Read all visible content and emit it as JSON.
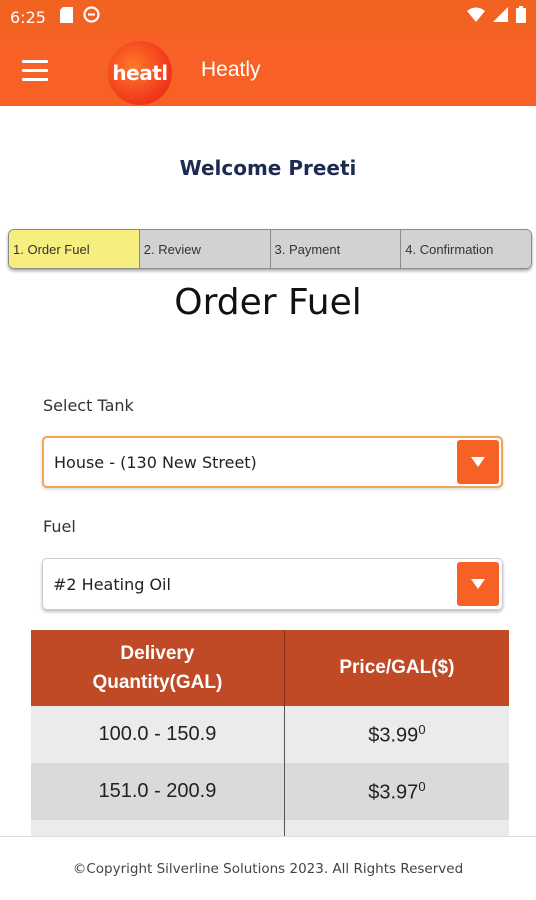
{
  "status_bar": {
    "time": "6:25",
    "icons": [
      "sd-card-icon",
      "do-not-disturb-icon",
      "wifi-icon",
      "signal-icon",
      "battery-icon"
    ]
  },
  "app_bar": {
    "logo_text": "heatl",
    "title": "Heatly",
    "color": "#f86125"
  },
  "welcome": "Welcome Preeti",
  "steps": [
    {
      "label": "1. Order Fuel",
      "active": true
    },
    {
      "label": "2. Review",
      "active": false
    },
    {
      "label": "3. Payment",
      "active": false
    },
    {
      "label": "4. Confirmation",
      "active": false
    }
  ],
  "page_title": "Order Fuel",
  "tank": {
    "label": "Select Tank",
    "value": "House - (130 New Street)"
  },
  "fuel": {
    "label": "Fuel",
    "value": "#2 Heating Oil"
  },
  "price_table": {
    "headers": [
      "Delivery Quantity(GAL)",
      "Price/GAL($)"
    ],
    "header_line1": "Delivery",
    "header_line2": "Quantity(GAL)",
    "rows": [
      {
        "range": "100.0 - 150.9",
        "price": "$3.99",
        "sup": "0"
      },
      {
        "range": "151.0 - 200.9",
        "price": "$3.97",
        "sup": "0"
      }
    ]
  },
  "footer": "©Copyright Silverline Solutions 2023. All Rights Reserved",
  "colors": {
    "accent": "#f86125",
    "table_header": "#bf4a25",
    "active_step": "#f6ee7e",
    "welcome_text": "#1f2a52"
  }
}
